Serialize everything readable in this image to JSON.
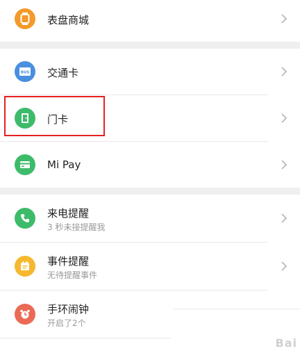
{
  "sections": [
    {
      "items": [
        {
          "id": "watch-store",
          "label": "表盘商城",
          "icon": "watch-icon",
          "color": "#f39a2b"
        }
      ]
    },
    {
      "items": [
        {
          "id": "transit-card",
          "label": "交通卡",
          "icon": "bus-card-icon",
          "color": "#4a8fe0"
        },
        {
          "id": "door-card",
          "label": "门卡",
          "icon": "door-icon",
          "color": "#3dbb6a",
          "highlighted": true
        },
        {
          "id": "mi-pay",
          "label": "Mi Pay",
          "icon": "card-icon",
          "color": "#3dbb6a"
        }
      ]
    },
    {
      "items": [
        {
          "id": "call-reminder",
          "label": "来电提醒",
          "subtitle": "3 秒未接提醒我",
          "icon": "phone-icon",
          "color": "#3dbb6a"
        },
        {
          "id": "event-reminder",
          "label": "事件提醒",
          "subtitle": "无待提醒事件",
          "icon": "calendar-icon",
          "color": "#f5b82e"
        },
        {
          "id": "alarm",
          "label": "手环闹钟",
          "subtitle": "开启了2个",
          "icon": "alarm-clock-icon",
          "color": "#ea6a55"
        }
      ]
    }
  ],
  "watermark": "Bai"
}
